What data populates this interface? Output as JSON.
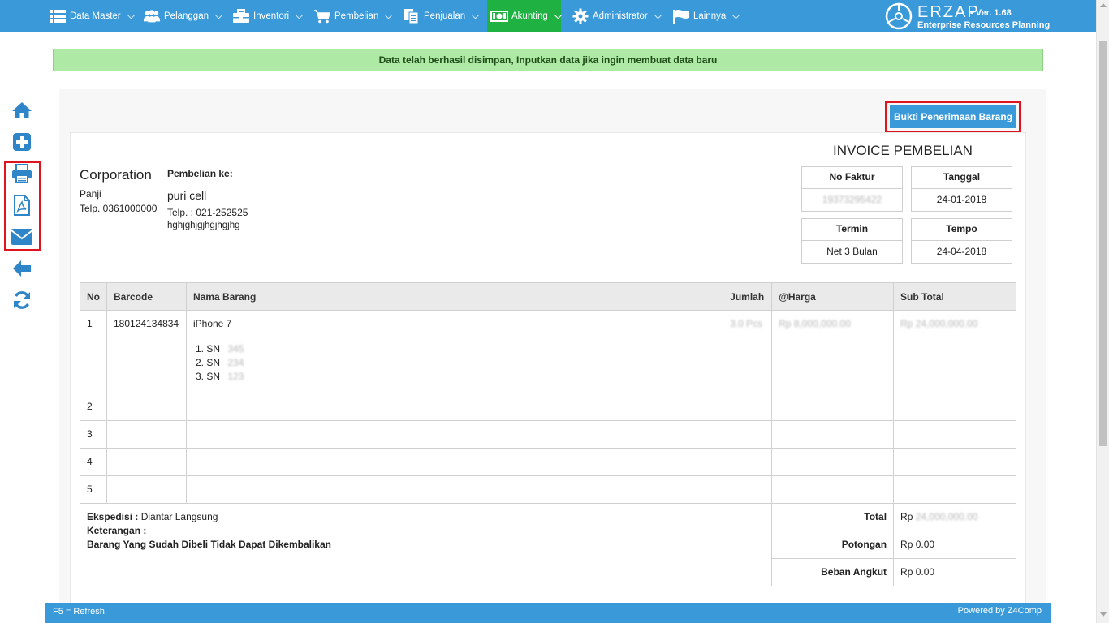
{
  "nav": {
    "items": [
      {
        "label": "Data Master",
        "icon": "list-icon"
      },
      {
        "label": "Pelanggan",
        "icon": "users-icon"
      },
      {
        "label": "Inventori",
        "icon": "briefcase-icon"
      },
      {
        "label": "Pembelian",
        "icon": "cart-icon"
      },
      {
        "label": "Penjualan",
        "icon": "documents-icon"
      },
      {
        "label": "Akunting",
        "icon": "money-icon"
      },
      {
        "label": "Administrator",
        "icon": "gear-icon"
      },
      {
        "label": "Lainnya",
        "icon": "flag-icon"
      }
    ],
    "active": "Akunting"
  },
  "brand": {
    "name": "ERZAP",
    "version": "- Ver. 1.68",
    "subtitle": "Enterprise Resources Planning"
  },
  "alert": {
    "message": "Data telah berhasil disimpan, Inputkan data jika ingin membuat data baru"
  },
  "sidebar": {
    "icons": [
      "home-icon",
      "plus-icon",
      "print-icon",
      "pdf-icon",
      "email-icon",
      "back-arrow-icon",
      "refresh-icon"
    ]
  },
  "actions": {
    "bukti_button": "Bukti Penerimaan Barang"
  },
  "invoice": {
    "title": "INVOICE PEMBELIAN",
    "company": {
      "name": "Corporation",
      "contact_name": "Panji",
      "phone": "Telp. 0361000000"
    },
    "supplier": {
      "heading": "Pembelian ke:",
      "name": "puri cell",
      "phone": "Telp.  : 021-252525",
      "address": "hghjghjgjhgjhgjhg"
    },
    "info": {
      "no_faktur_label": "No Faktur",
      "no_faktur_value": "19373295422",
      "tanggal_label": "Tanggal",
      "tanggal_value": "24-01-2018",
      "termin_label": "Termin",
      "termin_value": "Net 3 Bulan",
      "tempo_label": "Tempo",
      "tempo_value": "24-04-2018"
    },
    "table": {
      "headers": [
        "No",
        "Barcode",
        "Nama Barang",
        "Jumlah",
        "@Harga",
        "Sub Total"
      ],
      "row1": {
        "no": "1",
        "barcode": "180124134834",
        "nama": "iPhone 7",
        "jumlah": "3.0 Pcs",
        "harga": "Rp 8,000,000.00",
        "subtotal": "Rp 24,000,000.00",
        "serials": [
          {
            "label": "1. SN",
            "value": "345"
          },
          {
            "label": "2. SN",
            "value": "234"
          },
          {
            "label": "3. SN",
            "value": "123"
          }
        ]
      },
      "empty_rows": [
        "2",
        "3",
        "4",
        "5"
      ]
    },
    "footer": {
      "ekspedisi_label": "Ekspedisi :",
      "ekspedisi_value": "Diantar Langsung",
      "keterangan_label": "Keterangan :",
      "note": "Barang Yang Sudah Dibeli Tidak Dapat Dikembalikan",
      "total_label": "Total",
      "total_prefix": "Rp",
      "total_value": "24,000,000.00",
      "potongan_label": "Potongan",
      "potongan_value": "Rp 0.00",
      "beban_label": "Beban Angkut",
      "beban_value": "Rp 0.00"
    }
  },
  "status_bar": {
    "left": "F5 = Refresh",
    "right": "Powered by Z4Comp"
  },
  "colors": {
    "nav": "#3a9ad9",
    "active": "#1fb141",
    "alert_bg": "#aee9a6",
    "highlight": "#e0141e",
    "icon_blue": "#2e86c9"
  }
}
